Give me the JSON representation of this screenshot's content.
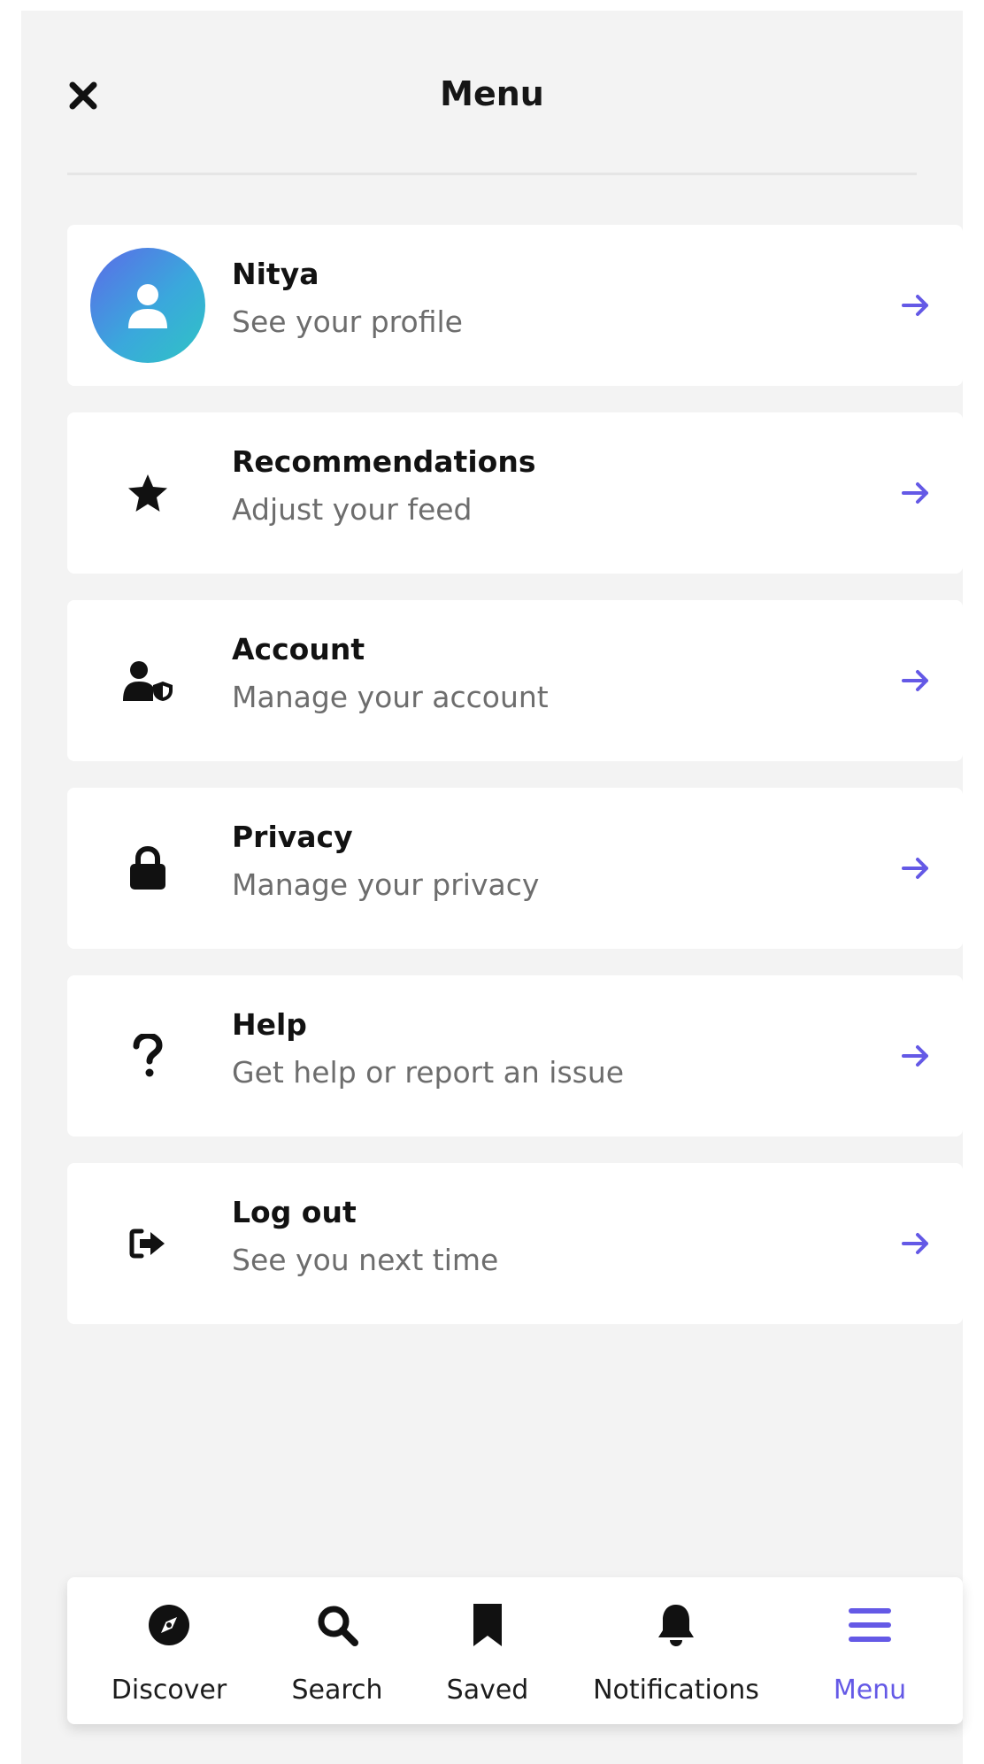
{
  "header": {
    "title": "Menu",
    "close_icon": "close-icon"
  },
  "colors": {
    "accent": "#6459e6",
    "background": "#f3f3f3",
    "card": "#ffffff",
    "subtitle": "#6d6d6d"
  },
  "profile": {
    "name": "Nitya",
    "subtitle": "See your profile",
    "icon": "user-icon"
  },
  "menu_items": [
    {
      "title": "Recommendations",
      "subtitle": "Adjust your feed",
      "icon": "star-icon"
    },
    {
      "title": "Account",
      "subtitle": "Manage your account",
      "icon": "user-shield-icon"
    },
    {
      "title": "Privacy",
      "subtitle": "Manage your privacy",
      "icon": "lock-icon"
    },
    {
      "title": "Help",
      "subtitle": "Get help or report an issue",
      "icon": "question-icon"
    },
    {
      "title": "Log out",
      "subtitle": "See you next time",
      "icon": "sign-out-icon"
    }
  ],
  "bottom_nav": [
    {
      "label": "Discover",
      "icon": "compass-icon",
      "active": false
    },
    {
      "label": "Search",
      "icon": "search-icon",
      "active": false
    },
    {
      "label": "Saved",
      "icon": "bookmark-icon",
      "active": false
    },
    {
      "label": "Notifications",
      "icon": "bell-icon",
      "active": false
    },
    {
      "label": "Menu",
      "icon": "hamburger-menu-icon",
      "active": true
    }
  ]
}
